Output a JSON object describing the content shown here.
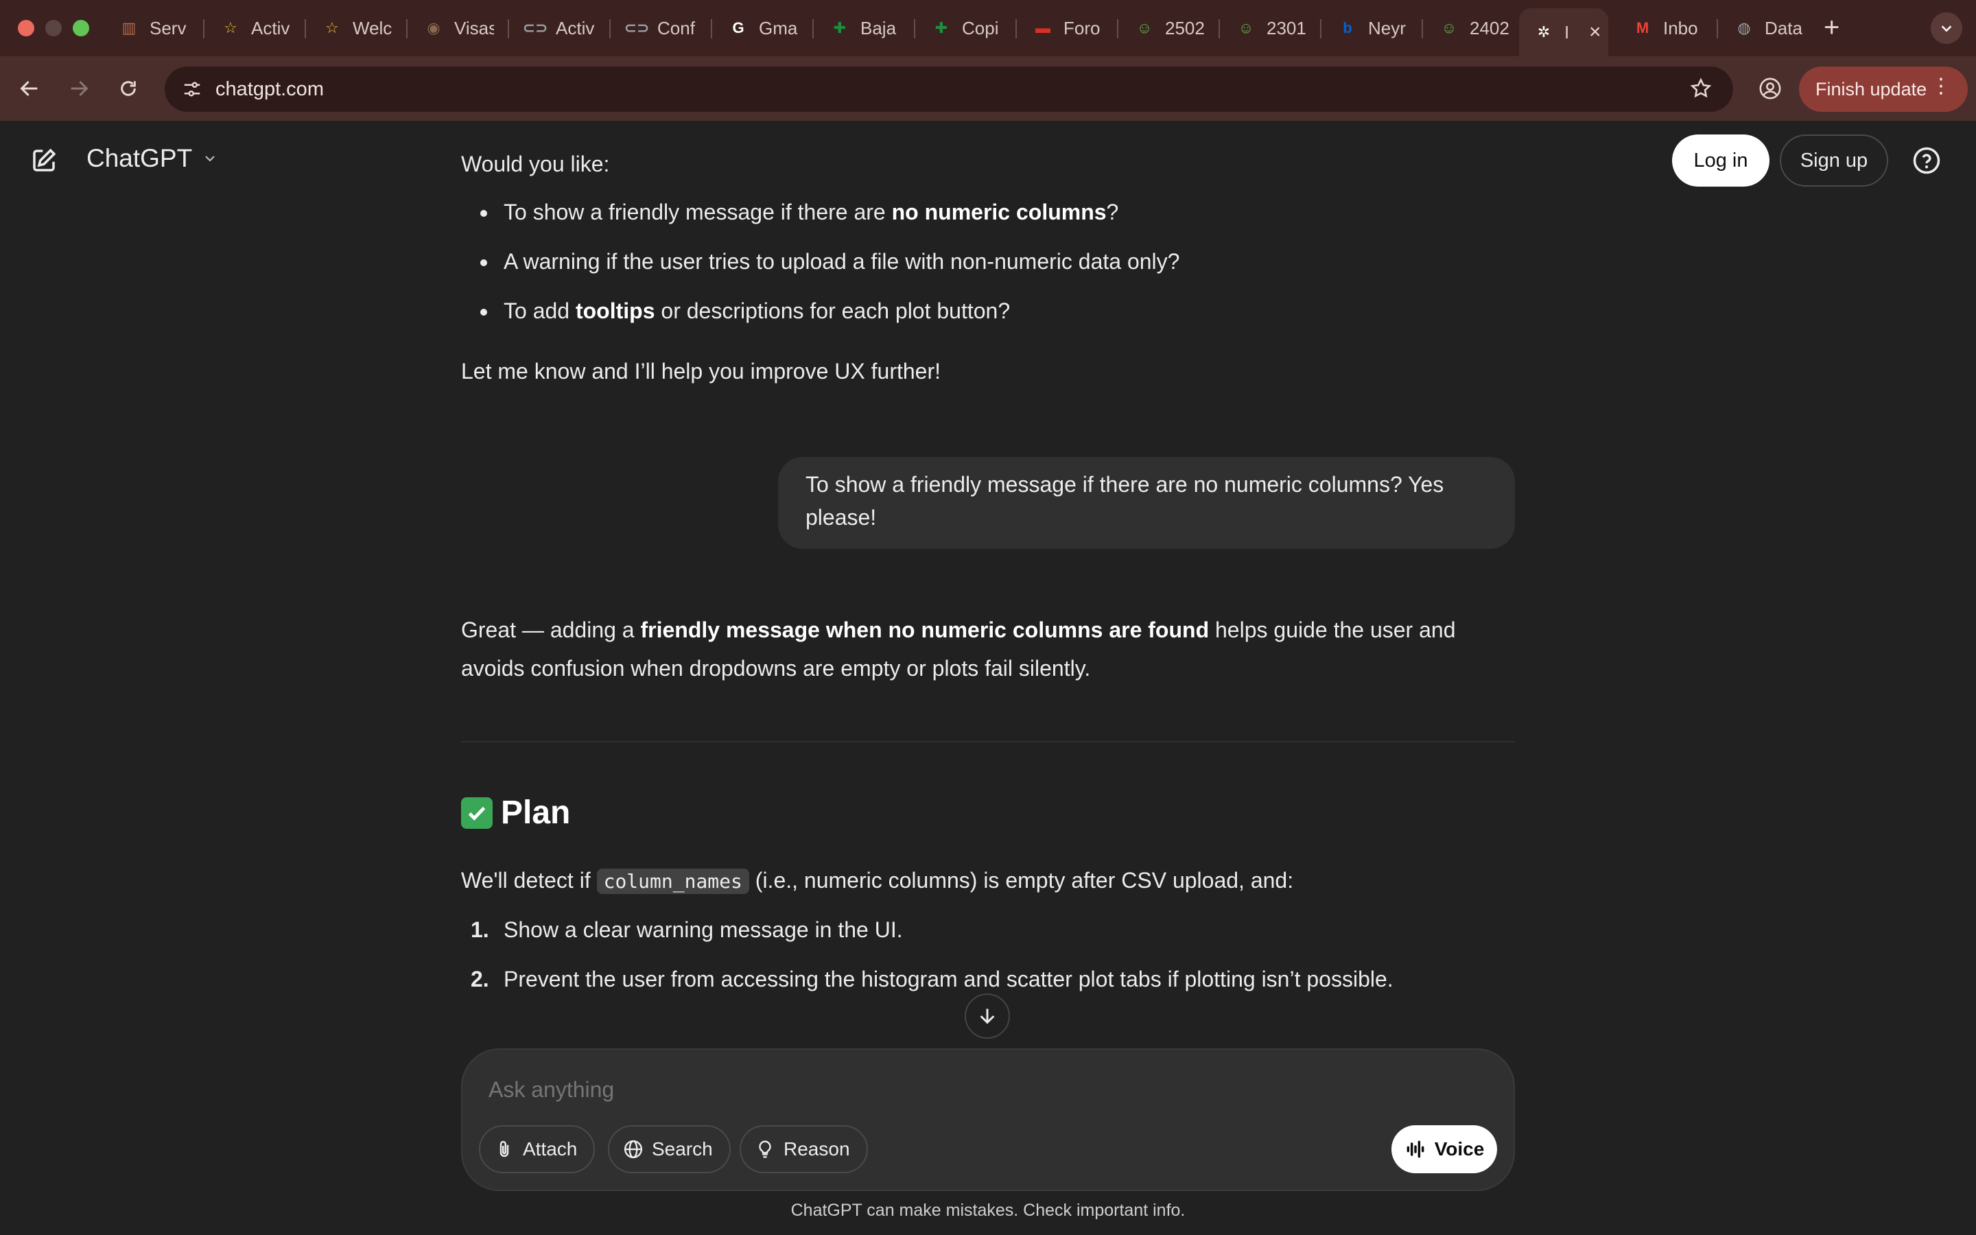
{
  "browser": {
    "tabs": [
      {
        "title": "Serv",
        "icon": "servicenow-icon",
        "color": "#b36b4a"
      },
      {
        "title": "Activ",
        "icon": "star-icon",
        "color": "#e0c23a"
      },
      {
        "title": "Welc",
        "icon": "star-icon",
        "color": "#e0c23a"
      },
      {
        "title": "Visas",
        "icon": "seal-icon",
        "color": "#8a6a50"
      },
      {
        "title": "Activ",
        "icon": "glassdoor-icon",
        "color": "#9aa0a6"
      },
      {
        "title": "Conf",
        "icon": "glassdoor-icon",
        "color": "#9aa0a6"
      },
      {
        "title": "Gma",
        "icon": "google-icon",
        "color": "#ffffff"
      },
      {
        "title": "Baja",
        "icon": "sheets-icon",
        "color": "#1e8e3e"
      },
      {
        "title": "Copi",
        "icon": "sheets-icon",
        "color": "#1e8e3e"
      },
      {
        "title": "Foro",
        "icon": "red-logo-icon",
        "color": "#d93025"
      },
      {
        "title": "2502",
        "icon": "smiley-icon",
        "color": "#5bb54a"
      },
      {
        "title": "2301",
        "icon": "smiley-icon",
        "color": "#5bb54a"
      },
      {
        "title": "Neyr",
        "icon": "box-icon",
        "color": "#0061d5"
      },
      {
        "title": "2402",
        "icon": "smiley-icon",
        "color": "#5bb54a"
      },
      {
        "title": "I",
        "icon": "openai-icon",
        "color": "#ffffff",
        "active": true
      },
      {
        "title": "Inbo",
        "icon": "gmail-icon",
        "color": "#ea4335"
      },
      {
        "title": "Data",
        "icon": "globe-icon",
        "color": "#9aa0a6"
      }
    ],
    "url": "chatgpt.com",
    "finish_update": "Finish update"
  },
  "header": {
    "model": "ChatGPT",
    "login": "Log in",
    "signup": "Sign up"
  },
  "thread": {
    "intro": "Would you like:",
    "bullets": [
      {
        "pre": "To show a friendly message if there are ",
        "bold": "no numeric columns",
        "post": "?"
      },
      {
        "pre": "A warning if the user tries to upload a file with non-numeric data only?",
        "bold": "",
        "post": ""
      },
      {
        "pre": "To add ",
        "bold": "tooltips",
        "post": " or descriptions for each plot button?"
      }
    ],
    "closing": "Let me know and I’ll help you improve UX further!",
    "user_message": "To show a friendly message if there are no numeric columns? Yes please!",
    "reply_pre": "Great — adding a ",
    "reply_bold": "friendly message when no numeric columns are found",
    "reply_post": " helps guide the user and avoids confusion when dropdowns are empty or plots fail silently.",
    "plan_heading": "Plan",
    "plan_pre": "We'll detect if ",
    "plan_code": "column_names",
    "plan_post": " (i.e., numeric columns) is empty after CSV upload, and:",
    "steps": [
      {
        "num": "1.",
        "text": "Show a clear warning message in the UI."
      },
      {
        "num": "2.",
        "text": "Prevent the user from accessing the histogram and scatter plot tabs if plotting isn’t possible."
      }
    ]
  },
  "composer": {
    "placeholder": "Ask anything",
    "attach": "Attach",
    "search": "Search",
    "reason": "Reason",
    "voice": "Voice"
  },
  "disclaimer": "ChatGPT can make mistakes. Check important info."
}
